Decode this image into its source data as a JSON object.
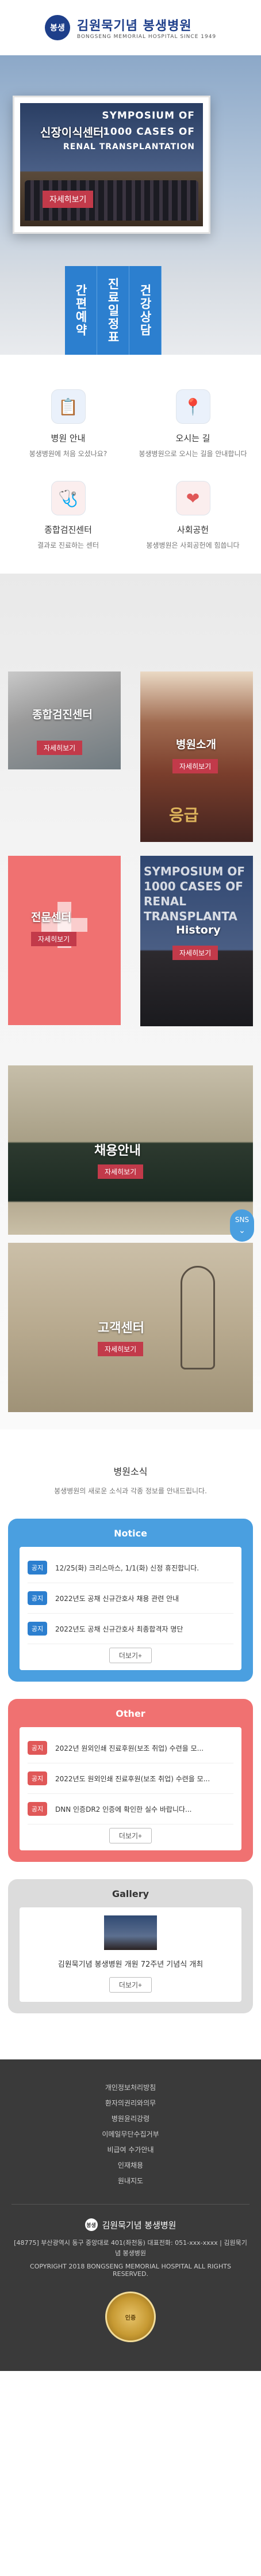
{
  "header": {
    "logo_mark": "봉생",
    "logo_main": "김원묵기념 봉생병원",
    "logo_sub": "BONGSENG MEMORIAL HOSPITAL SINCE 1949"
  },
  "hero": {
    "banner_lines": [
      "SYMPOSIUM OF",
      "1000 CASES OF",
      "RENAL TRANSPLANTATION"
    ],
    "title": "신장이식센터",
    "detail_button": "자세히보기",
    "quick_menu": [
      "간편예약",
      "진료일정표",
      "건강상담"
    ]
  },
  "icon_menu": [
    {
      "icon": "calendar-icon",
      "glyph": "📋",
      "title": "병원 안내",
      "desc": "봉생병원에 처음 오셨나요?"
    },
    {
      "icon": "map-pin-icon",
      "glyph": "📍",
      "title": "오시는 길",
      "desc": "봉생병원으로 오시는 길을 안내합니다"
    },
    {
      "icon": "checkup-icon",
      "glyph": "🩺",
      "title": "종합검진센터",
      "desc": "결과로 진료하는 센터"
    },
    {
      "icon": "heart-hand-icon",
      "glyph": "❤",
      "title": "사회공헌",
      "desc": "봉생병원은 사회공헌에 힘씁니다"
    }
  ],
  "tiles": {
    "health_center": {
      "label": "종합검진센터",
      "button": "자세히보기"
    },
    "intro": {
      "label": "병원소개",
      "button": "자세히보기",
      "sign": "응급"
    },
    "specialty": {
      "label": "전문센터",
      "button": "자세히보기"
    },
    "history": {
      "label": "History",
      "button": "자세히보기",
      "banner": "SYMPOSIUM OF 1000 CASES OF RENAL TRANSPLANTA"
    },
    "recruit": {
      "label": "채용안내",
      "button": "자세히보기"
    },
    "customer": {
      "label": "고객센터",
      "button": "자세히보기"
    }
  },
  "sns": {
    "label": "SNS",
    "chevron": "⌄"
  },
  "news": {
    "title": "병원소식",
    "subtitle": "봉생병원의 새로운 소식과 각종 정보를 안내드립니다."
  },
  "notice": {
    "title": "Notice",
    "color": "#4a9fe0",
    "tag_color": "#2c7fcf",
    "items": [
      {
        "tag": "공지",
        "text": "12/25(화) 크리스마스, 1/1(화) 신정 휴진합니다."
      },
      {
        "tag": "공지",
        "text": "2022년도 공채 신규간호사 채용 관련 안내"
      },
      {
        "tag": "공지",
        "text": "2022년도 공채 신규간호사 최종합격자 명단"
      }
    ],
    "more": "더보기+"
  },
  "other": {
    "title": "Other",
    "color": "#f07171",
    "tag_color": "#e05858",
    "items": [
      {
        "tag": "공지",
        "text": "2022년 원외인쇄 진료후원(보조 취업) 수련을 모..."
      },
      {
        "tag": "공지",
        "text": "2022년도 원외인쇄 진료후원(보조 취업) 수련을 모..."
      },
      {
        "tag": "공지",
        "text": "DNN 인증DR2 인증에 확인한 실수 바랍니다..."
      }
    ],
    "more": "더보기+"
  },
  "gallery": {
    "title": "Gallery",
    "color": "#dcdcdc",
    "caption": "김원묵기념 봉생병원 개원 72주년 기념식 개최",
    "more": "더보기+"
  },
  "footer": {
    "links": [
      "개인정보처리방침",
      "환자의권리와의무",
      "병원윤리강령",
      "이메일무단수집거부",
      "비급여 수가안내",
      "인재채용",
      "원내지도"
    ],
    "logo_mark": "봉생",
    "logo_name": "김원묵기념 봉생병원",
    "address": "[48775] 부산광역시 동구 중앙대로 401(좌천동) 대표전화: 051-xxx-xxxx | 김원묵기념 봉생병원",
    "copyright": "COPYRIGHT 2018 BONGSENG MEMORIAL HOSPITAL ALL RIGHTS RESERVED.",
    "seal_text": "인증"
  }
}
